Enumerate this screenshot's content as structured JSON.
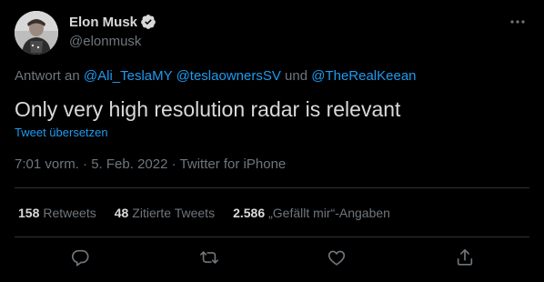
{
  "author": {
    "display_name": "Elon Musk",
    "handle": "@elonmusk"
  },
  "reply_to": {
    "prefix": "Antwort an",
    "mention_1": "@Ali_TeslaMY",
    "mention_2": "@teslaownersSV",
    "conjunction": "und",
    "mention_3": "@TheRealKeean"
  },
  "tweet": {
    "text": "Only very high resolution radar is relevant",
    "translate_label": "Tweet übersetzen",
    "time": "7:01 vorm.",
    "separator": "·",
    "date": "5. Feb. 2022",
    "source": "Twitter for iPhone"
  },
  "stats": {
    "retweets_count": "158",
    "retweets_label": "Retweets",
    "quotes_count": "48",
    "quotes_label": "Zitierte Tweets",
    "likes_count": "2.586",
    "likes_label": "„Gefällt mir“-Angaben"
  },
  "icons": {
    "reply": "reply-icon",
    "retweet": "retweet-icon",
    "like": "heart-icon",
    "share": "share-icon",
    "more": "more-icon",
    "verified": "verified-badge-icon"
  },
  "colors": {
    "background": "#000000",
    "text_primary": "#d9d9d9",
    "text_secondary": "#6e767d",
    "link": "#1d9bf0",
    "divider": "#2f3336"
  }
}
